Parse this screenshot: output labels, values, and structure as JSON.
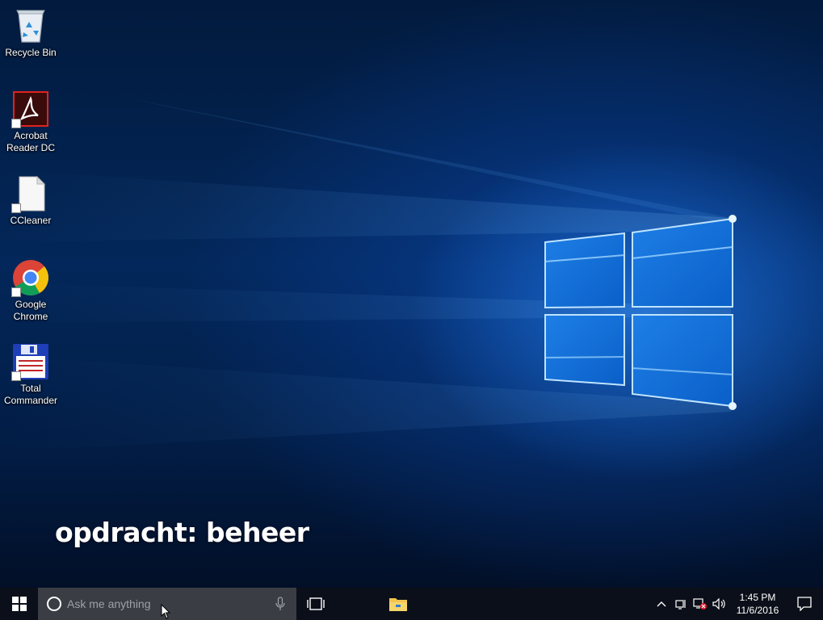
{
  "desktop_icons": [
    {
      "label": "Recycle Bin",
      "icon": "recycle-bin-icon"
    },
    {
      "label": "Acrobat Reader DC",
      "icon": "acrobat-reader-icon"
    },
    {
      "label": "CCleaner",
      "icon": "ccleaner-icon"
    },
    {
      "label": "Google Chrome",
      "icon": "chrome-icon"
    },
    {
      "label": "Total Commander",
      "icon": "total-commander-icon"
    }
  ],
  "overlay_text": "opdracht: beheer",
  "taskbar": {
    "search_placeholder": "Ask me anything",
    "pinned": [
      {
        "name": "task-view",
        "icon": "task-view-icon"
      },
      {
        "name": "file-explorer",
        "icon": "folder-icon"
      }
    ],
    "clock": {
      "time": "1:45 PM",
      "date": "11/6/2016"
    },
    "tray_icons": [
      "chevron-up-icon",
      "network-icon",
      "network-error-icon",
      "volume-icon"
    ]
  },
  "colors": {
    "wallpaper_dark": "#021a3d",
    "wallpaper_glow": "#288cff",
    "taskbar": "#0b0f19",
    "search_box": "#3a3d44"
  }
}
